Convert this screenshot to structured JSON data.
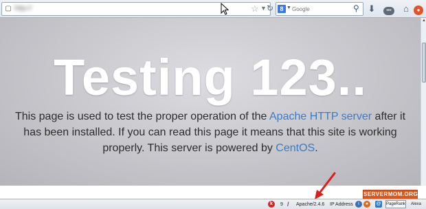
{
  "toolbar": {
    "url": "http://",
    "search_placeholder": "Google",
    "search_engine_letter": "8",
    "addon_button_label": "•••",
    "extension_badge": "●"
  },
  "page": {
    "title": "Testing 123..",
    "text_1": "This page is used to test the proper operation of the",
    "link_apache": "Apache HTTP server",
    "text_2": "after it has been installed. If you can read this page it means that this site is working properly. This server is powered by",
    "link_centos": "CentOS",
    "text_end": "."
  },
  "watermark": "SERVERMOM.ORG",
  "statusbar": {
    "k_icon": "k",
    "count": "9",
    "server": "Apache/2.4.6",
    "ip_label": "IP Address",
    "info_icon": "i",
    "ff_icon": "●",
    "pr_icon": "@",
    "pagerank_label": "PageRank",
    "alexa_label": "Alexa"
  },
  "colors": {
    "link": "#3a7bc8",
    "arrow": "#e01b1b",
    "watermark_bg": "#d9571c"
  }
}
